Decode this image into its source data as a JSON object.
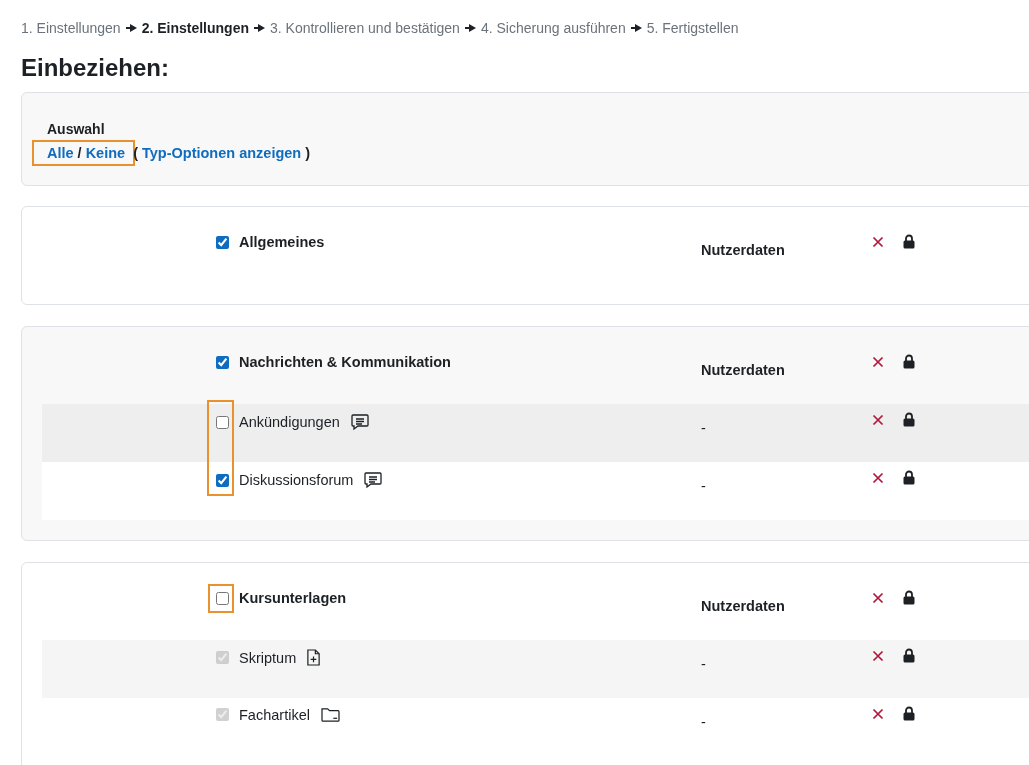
{
  "breadcrumb": [
    {
      "label": "1. Einstellungen",
      "selected": false
    },
    {
      "label": "2. Einstellungen",
      "selected": true
    },
    {
      "label": "3. Kontrollieren und bestätigen",
      "selected": false
    },
    {
      "label": "4. Sicherung ausführen",
      "selected": false
    },
    {
      "label": "5. Fertigstellen",
      "selected": false
    }
  ],
  "heading": "Einbeziehen:",
  "selection": {
    "label": "Auswahl",
    "parts": [
      {
        "kind": "link",
        "text": "Alle",
        "highlighted": true
      },
      {
        "kind": "text",
        "text": "/",
        "highlighted": true
      },
      {
        "kind": "link",
        "text": "Keine",
        "highlighted": true
      },
      {
        "kind": "text",
        "text": "(",
        "highlighted": false
      },
      {
        "kind": "link",
        "text": "Typ-Optionen anzeigen",
        "highlighted": false
      },
      {
        "kind": "text",
        "text": ")",
        "highlighted": false
      }
    ]
  },
  "sections": [
    {
      "label": "Allgemeines",
      "checked": true,
      "highlighted": false,
      "userdata": "Nutzerdaten"
    },
    {
      "label": "Nachrichten & Kommunikation",
      "checked": true,
      "highlighted": false,
      "userdata": "Nutzerdaten",
      "activities": [
        {
          "label": "Ankündigungen",
          "kind": "forum",
          "checked": false,
          "disabled": false,
          "highlighted": true,
          "userdata": "-"
        },
        {
          "label": "Diskussionsforum",
          "kind": "forum",
          "checked": true,
          "disabled": false,
          "highlighted": true,
          "userdata": "-"
        }
      ]
    },
    {
      "label": "Kursunterlagen",
      "checked": false,
      "highlighted": true,
      "userdata": "Nutzerdaten",
      "activities": [
        {
          "label": "Skriptum",
          "kind": "page",
          "checked": true,
          "disabled": true,
          "highlighted": false,
          "userdata": "-"
        },
        {
          "label": "Fachartikel",
          "kind": "folder",
          "checked": true,
          "disabled": true,
          "highlighted": false,
          "userdata": "-"
        }
      ]
    }
  ]
}
